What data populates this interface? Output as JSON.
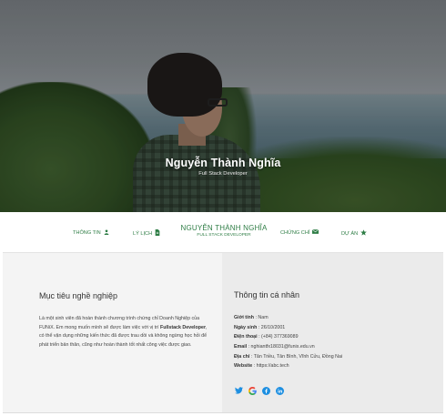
{
  "hero": {
    "name": "Nguyễn Thành Nghĩa",
    "role": "Full Stack Developer"
  },
  "nav": {
    "items": [
      {
        "label": "THÔNG TIN",
        "icon": "user-icon"
      },
      {
        "label": "LÝ LỊCH",
        "icon": "document-icon"
      },
      {
        "label": "CHỨNG CHỈ",
        "icon": "envelope-icon"
      },
      {
        "label": "DỰ ÁN",
        "icon": "star-icon"
      }
    ],
    "brand_title": "NGUYỄN THÀNH NGHĨA",
    "brand_subtitle": "FULL STACK DEVELOPER"
  },
  "goal": {
    "title": "Mục tiêu nghề nghiệp",
    "text_part1": "Là một sinh viên đã hoàn thành chương trình chứng chỉ Doanh Nghiệp của FUNiX. Em mong muốn mình sẽ được làm việc với vị trí ",
    "text_bold": "Fullstack Developer",
    "text_part2": ", có thể vận dụng những kiến thức đã được trau dồi và không ngừng học hỏi để phát triển bản thân, cũng như hoàn thành tốt nhất công việc được giao."
  },
  "info": {
    "title": "Thông tin cá nhân",
    "rows": [
      {
        "label": "Giới tính",
        "value": " : Nam"
      },
      {
        "label": "Ngày sinh",
        "value": " : 26/10/2001"
      },
      {
        "label": "Điện thoại",
        "value": " : (+84) 377369089"
      },
      {
        "label": "Email",
        "value": " : nghiantfx18031@funix.edu.vn"
      },
      {
        "label": "Địa chỉ",
        "value": " : Tân Triều, Tân Bình, Vĩnh Cửu, Đồng Nai"
      },
      {
        "label": "Website",
        "value": " : https://abc.tech"
      }
    ],
    "social": [
      "twitter-icon",
      "google-icon",
      "facebook-icon",
      "linkedin-icon"
    ]
  },
  "colors": {
    "accent_green": "#2e7d45",
    "social_blue": "#1d8fe1"
  }
}
